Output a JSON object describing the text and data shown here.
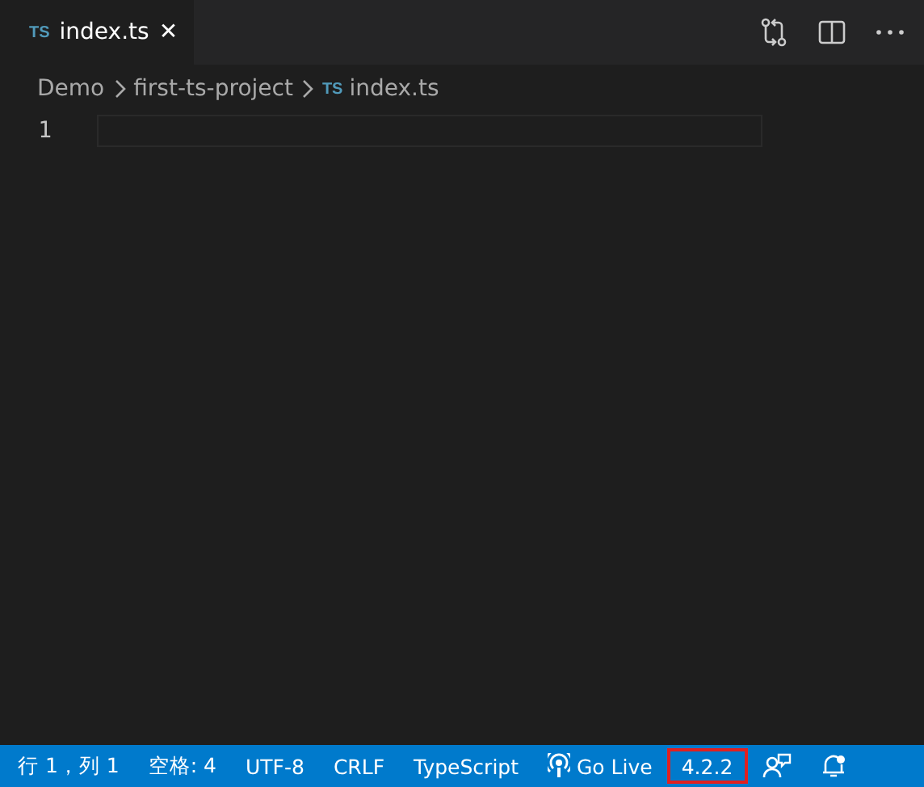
{
  "tabs": [
    {
      "label": "index.ts",
      "badge": "TS",
      "selected": true,
      "close": "✕"
    }
  ],
  "breadcrumbs": [
    {
      "label": "Demo"
    },
    {
      "label": "first-ts-project"
    },
    {
      "label": "index.ts",
      "badge": "TS"
    }
  ],
  "editor": {
    "line_numbers": [
      "1"
    ]
  },
  "status_bar": [
    {
      "kind": "text",
      "label": "行 1，列 1",
      "highlighted": false
    },
    {
      "kind": "text",
      "label": "空格: 4",
      "highlighted": false
    },
    {
      "kind": "text",
      "label": "UTF-8",
      "highlighted": false
    },
    {
      "kind": "text",
      "label": "CRLF",
      "highlighted": false
    },
    {
      "kind": "text",
      "label": "TypeScript",
      "highlighted": false
    },
    {
      "kind": "golive",
      "label": "Go Live",
      "highlighted": false
    },
    {
      "kind": "text",
      "label": "4.2.2",
      "highlighted": true
    },
    {
      "kind": "feedback",
      "highlighted": false
    },
    {
      "kind": "bell",
      "highlighted": false
    }
  ]
}
